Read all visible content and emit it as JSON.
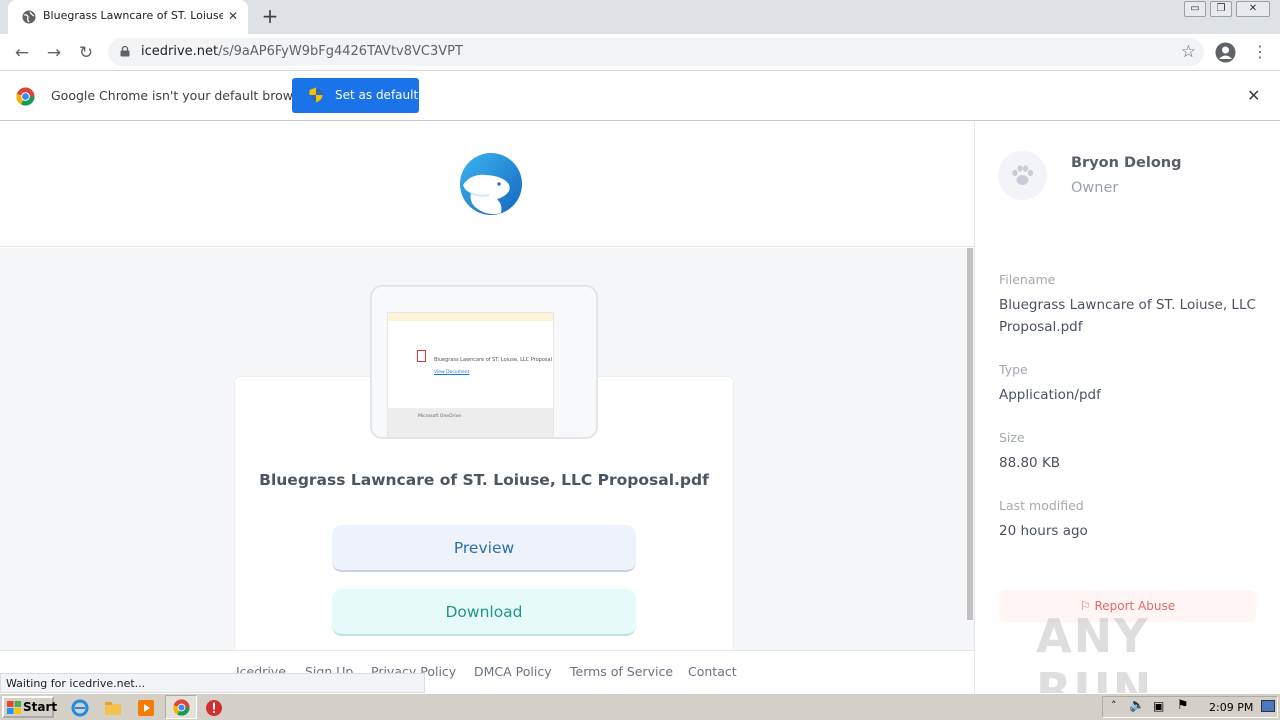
{
  "browser": {
    "tab_title": "Bluegrass Lawncare of ST. Loiuse, LLC Proposal.pdf",
    "tab_close": "✕",
    "new_tab": "+",
    "url_host": "icedrive.net",
    "url_path": "/s/9aAP6FyW9bFg4426TAVtv8VC3VPT",
    "window_controls": [
      "▭",
      "❐",
      "✕"
    ]
  },
  "infobar": {
    "message": "Google Chrome isn't your default browser",
    "button": "Set as default",
    "close": "✕"
  },
  "file": {
    "title": "Bluegrass Lawncare of ST. Loiuse, LLC Proposal.pdf",
    "preview_label": "Preview",
    "download_label": "Download"
  },
  "thumbnail": {
    "doc_name": "Bluegrass Lawncare of ST. Loiuse, LLC Proposal",
    "link": "View Document",
    "brand": "Microsoft OneDrive"
  },
  "footer": {
    "links": [
      "Icedrive",
      "Sign Up",
      "Privacy Policy",
      "DMCA Policy",
      "Terms of Service",
      "Contact"
    ]
  },
  "owner": {
    "name": "Bryon Delong",
    "role": "Owner"
  },
  "details": {
    "filename_label": "Filename",
    "filename_value": "Bluegrass Lawncare of ST. Loiuse, LLC Proposal.pdf",
    "type_label": "Type",
    "type_value": "Application/pdf",
    "size_label": "Size",
    "size_value": "88.80 KB",
    "modified_label": "Last modified",
    "modified_value": "20 hours ago"
  },
  "report_abuse": "Report Abuse",
  "watermark": "ANY RUN",
  "status_text": "Waiting for icedrive.net...",
  "taskbar": {
    "start_label": "Start",
    "clock": "2:09 PM"
  },
  "colors": {
    "accent_blue": "#1a73e8",
    "preview_text": "#2c6fa6",
    "download_text": "#20958a",
    "report_red": "#e46a6a"
  }
}
